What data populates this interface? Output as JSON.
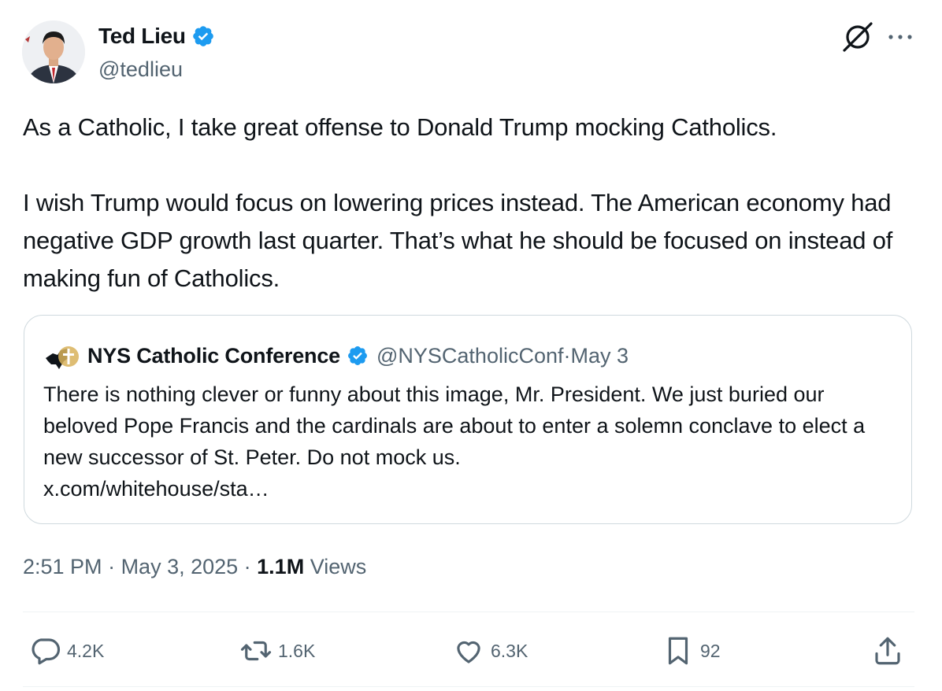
{
  "author": {
    "name": "Ted Lieu",
    "handle": "@tedlieu",
    "verified": true
  },
  "tweet": {
    "text": "As a Catholic, I take great offense to Donald Trump mocking Catholics.\n\nI wish Trump would focus on lowering prices instead. The American economy had negative GDP growth last quarter. That’s what he should be focused on instead of making fun of Catholics."
  },
  "quote": {
    "name": "NYS Catholic Conference",
    "handle": "@NYSCatholicConf",
    "separator": " · ",
    "date": "May 3",
    "text": "There is nothing clever or funny about this image, Mr. President. We just buried our beloved Pope Francis and the cardinals are about to enter a solemn conclave to elect a new successor of St. Peter. Do not mock us.\nx.com/whitehouse/sta…"
  },
  "meta": {
    "time": "2:51 PM",
    "sep1": " · ",
    "date": "May 3, 2025",
    "sep2": " · ",
    "views_count": "1.1M",
    "views_label": " Views"
  },
  "actions": {
    "replies": "4.2K",
    "reposts": "1.6K",
    "likes": "6.3K",
    "bookmarks": "92"
  },
  "colors": {
    "verified_blue": "#1d9bf0",
    "secondary_text": "#536471",
    "border": "#cfd9de"
  },
  "icons": [
    "grok-icon",
    "more-icon",
    "reply-icon",
    "repost-icon",
    "like-icon",
    "bookmark-icon",
    "share-icon",
    "verified-badge-icon"
  ]
}
